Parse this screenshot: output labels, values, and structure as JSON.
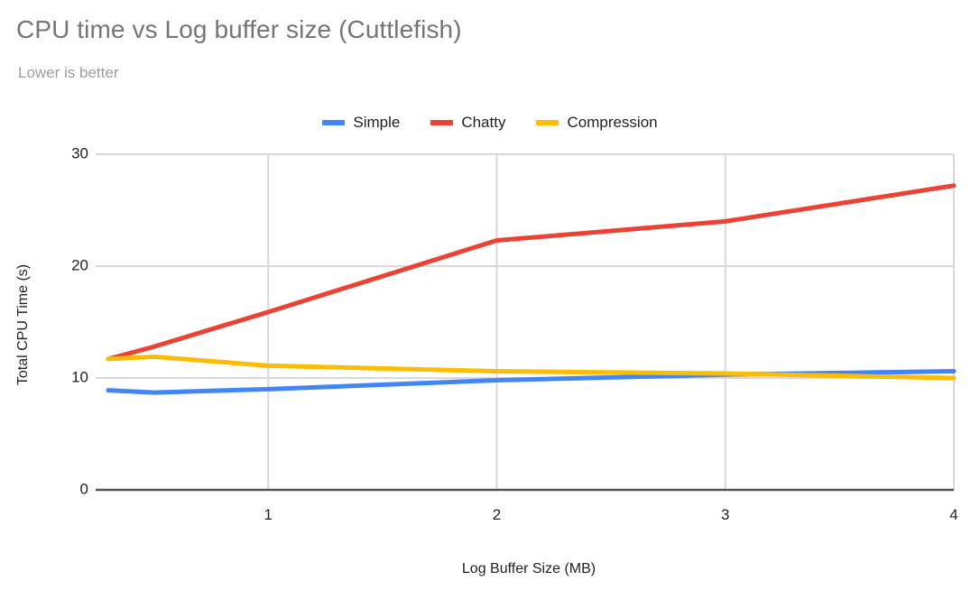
{
  "chart_data": {
    "type": "line",
    "title": "CPU time vs Log buffer size (Cuttlefish)",
    "subtitle": "Lower is better",
    "xlabel": "Log Buffer Size (MB)",
    "ylabel": "Total CPU Time (s)",
    "xlim": [
      0.3,
      4
    ],
    "ylim": [
      0,
      30
    ],
    "yticks": [
      0,
      10,
      20,
      30
    ],
    "ytick_labels": [
      "0",
      "10",
      "20",
      "30"
    ],
    "xticks": [
      1,
      2,
      3,
      4
    ],
    "xtick_labels": [
      "1",
      "2",
      "3",
      "4"
    ],
    "grid": true,
    "legend_position": "top-center",
    "x": [
      0.3,
      0.5,
      1,
      2,
      3,
      4
    ],
    "series": [
      {
        "name": "Simple",
        "color": "#4285F4",
        "values": [
          8.9,
          8.7,
          9.0,
          9.8,
          10.3,
          10.6
        ]
      },
      {
        "name": "Chatty",
        "color": "#EA4335",
        "values": [
          11.7,
          12.8,
          15.9,
          22.3,
          24.0,
          27.2
        ]
      },
      {
        "name": "Compression",
        "color": "#FBBC04",
        "values": [
          11.7,
          11.9,
          11.1,
          10.6,
          10.4,
          10.0
        ]
      }
    ]
  },
  "header": {
    "title": "CPU time vs Log buffer size (Cuttlefish)",
    "subtitle": "Lower is better"
  },
  "legend": {
    "items": [
      {
        "label": "Simple",
        "color": "#4285F4"
      },
      {
        "label": "Chatty",
        "color": "#EA4335"
      },
      {
        "label": "Compression",
        "color": "#FBBC04"
      }
    ]
  },
  "axes": {
    "x_title": "Log Buffer Size (MB)",
    "y_title": "Total CPU Time (s)"
  }
}
